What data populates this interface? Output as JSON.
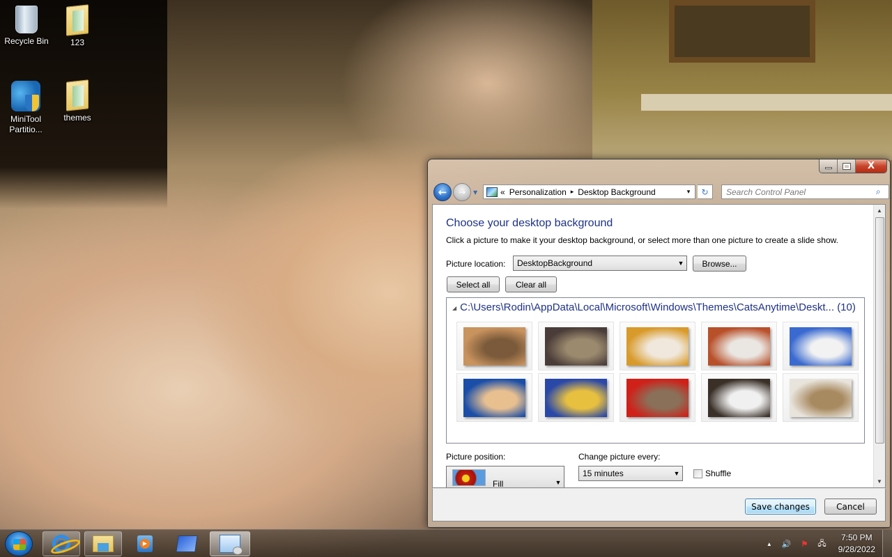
{
  "desktop": {
    "icons": [
      {
        "label": "Recycle Bin",
        "icon": "recycle-bin-icon"
      },
      {
        "label": "123",
        "icon": "folder-icon"
      },
      {
        "label": "MiniTool Partitio...",
        "icon": "minitool-partition-icon"
      },
      {
        "label": "themes",
        "icon": "folder-icon"
      }
    ]
  },
  "window": {
    "caption_buttons": {
      "minimize": "minimize",
      "maximize": "maximize",
      "close": "X"
    },
    "nav": {
      "back": "←",
      "forward": "→"
    },
    "address": {
      "prefix": "«",
      "crumbs": [
        "Personalization",
        "Desktop Background"
      ],
      "separator": "▸",
      "dropdown": "▾"
    },
    "refresh_glyph": "↻",
    "search": {
      "placeholder": "Search Control Panel",
      "icon": "⌕"
    },
    "content": {
      "title": "Choose your desktop background",
      "description": "Click a picture to make it your desktop background, or select more than one picture to create a slide show.",
      "picture_location_label": "Picture location:",
      "picture_location_value": "DesktopBackground",
      "browse_label": "Browse...",
      "select_all_label": "Select all",
      "clear_all_label": "Clear all",
      "gallery": {
        "path": "C:\\Users\\Rodin\\AppData\\Local\\Microsoft\\Windows\\Themes\\CatsAnytime\\Deskt...",
        "count": "(10)",
        "thumbnails": [
          {
            "name": "ginger cat lying",
            "colors": [
              "#c9935e",
              "#7a5a3a"
            ]
          },
          {
            "name": "tabby cat peeking",
            "colors": [
              "#4a3c38",
              "#9b8a6e"
            ]
          },
          {
            "name": "calico cat in basket with pumpkins",
            "colors": [
              "#d89a2a",
              "#f0e8dc"
            ]
          },
          {
            "name": "white cat against orange wall",
            "colors": [
              "#b8502a",
              "#eae6e2"
            ]
          },
          {
            "name": "black and white cat with ball",
            "colors": [
              "#3a6ad0",
              "#f2f2f2"
            ]
          },
          {
            "name": "ginger kitten on blue blanket",
            "colors": [
              "#1a4ea8",
              "#e8c090"
            ]
          },
          {
            "name": "cat in blue polka-dot tent",
            "colors": [
              "#2a48a8",
              "#e8c040"
            ]
          },
          {
            "name": "cat in red bag",
            "colors": [
              "#d02018",
              "#8a7058"
            ]
          },
          {
            "name": "calico cat close-up",
            "colors": [
              "#3a3028",
              "#f0f0f0"
            ]
          },
          {
            "name": "white and tabby cat resting",
            "colors": [
              "#e8e4dc",
              "#a88a60"
            ]
          }
        ]
      },
      "picture_position_label": "Picture position:",
      "picture_position_value": "Fill",
      "change_every_label": "Change picture every:",
      "change_every_value": "15 minutes",
      "shuffle_label": "Shuffle",
      "shuffle_checked": false
    },
    "footer": {
      "save_label": "Save changes",
      "cancel_label": "Cancel"
    }
  },
  "taskbar": {
    "apps": [
      {
        "name": "internet-explorer"
      },
      {
        "name": "windows-explorer"
      },
      {
        "name": "windows-media-player"
      },
      {
        "name": "network"
      },
      {
        "name": "control-panel",
        "active": true
      }
    ],
    "tray": {
      "show_hidden": "▲",
      "volume": "🔊",
      "clock_time": "7:50 PM",
      "clock_date": "9/28/2022"
    }
  }
}
